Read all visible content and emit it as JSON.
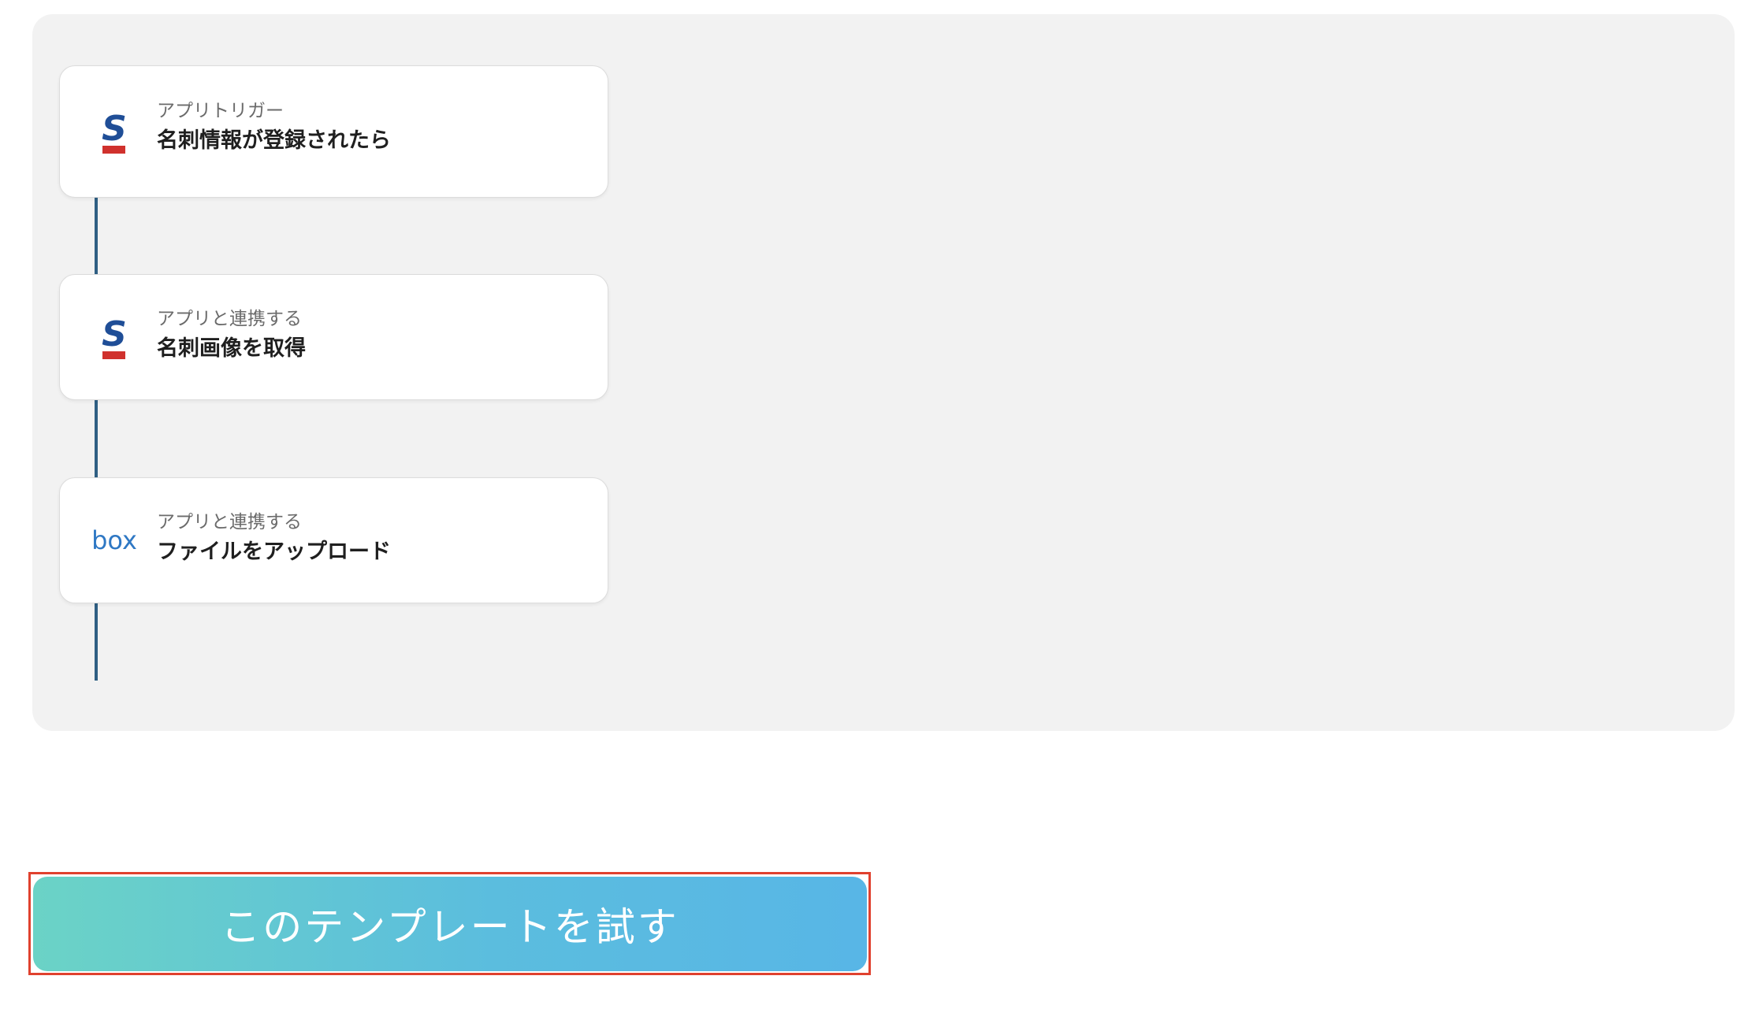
{
  "flow": {
    "steps": [
      {
        "kind": "アプリトリガー",
        "title": "名刺情報が登録されたら",
        "icon": "sansan-icon"
      },
      {
        "kind": "アプリと連携する",
        "title": "名刺画像を取得",
        "icon": "sansan-icon"
      },
      {
        "kind": "アプリと連携する",
        "title": "ファイルをアップロード",
        "icon": "box-icon"
      }
    ]
  },
  "cta": {
    "label": "このテンプレートを試す"
  },
  "colors": {
    "connector": "#2f5f83",
    "sansan_blue": "#1f4e97",
    "sansan_red": "#d0312d",
    "box_blue": "#2f78c4",
    "cta_gradient_start": "#6bd3c6",
    "cta_gradient_end": "#58b6e6",
    "highlight_border": "#e0412e"
  }
}
